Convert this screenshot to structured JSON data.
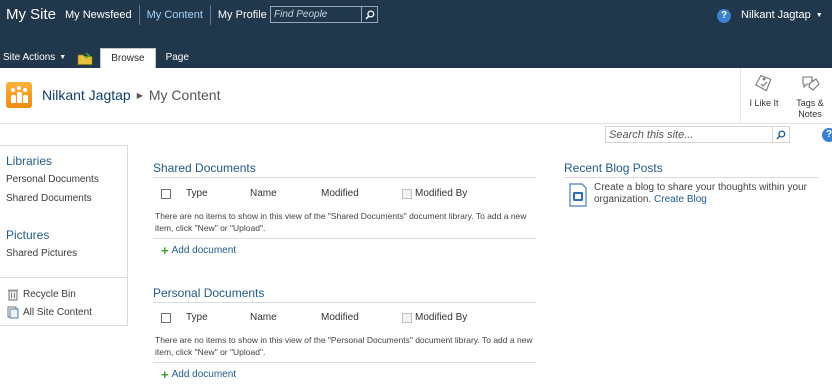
{
  "top_nav": {
    "site_title": "My Site",
    "items": [
      {
        "label": "My Newsfeed"
      },
      {
        "label": "My Content"
      },
      {
        "label": "My Profile"
      }
    ],
    "search_placeholder": "Find People",
    "user_name": "Nilkant Jagtap"
  },
  "ribbon": {
    "site_actions": "Site Actions",
    "tabs": [
      "Browse",
      "Page"
    ],
    "actions": [
      {
        "label": "I Like It"
      },
      {
        "label": "Tags & Notes"
      }
    ]
  },
  "breadcrumb": {
    "home": "Nilkant Jagtap",
    "current": "My Content"
  },
  "site_search": {
    "placeholder": "Search this site..."
  },
  "quick_launch": {
    "libraries_heading": "Libraries",
    "libraries": [
      "Personal Documents",
      "Shared Documents"
    ],
    "pictures_heading": "Pictures",
    "pictures": [
      "Shared Pictures"
    ],
    "recycle_bin": "Recycle Bin",
    "all_site_content": "All Site Content"
  },
  "shared_documents": {
    "title": "Shared Documents",
    "columns": [
      "Type",
      "Name",
      "Modified",
      "Modified By"
    ],
    "empty_message": "There are no items to show in this view of the \"Shared Documents\" document library. To add a new item, click \"New\" or \"Upload\".",
    "add_label": "Add document"
  },
  "personal_documents": {
    "title": "Personal Documents",
    "columns": [
      "Type",
      "Name",
      "Modified",
      "Modified By"
    ],
    "empty_message": "There are no items to show in this view of the \"Personal Documents\" document library. To add a new item, click \"New\" or \"Upload\".",
    "add_label": "Add document"
  },
  "recent_blog_posts": {
    "title": "Recent Blog Posts",
    "text": "Create a blog to share your thoughts within your organization.",
    "link": "Create Blog"
  },
  "colors": {
    "top_bar": "#21374c",
    "link_blue": "#1f5b8f",
    "active_nav": "#a6d4f7"
  }
}
